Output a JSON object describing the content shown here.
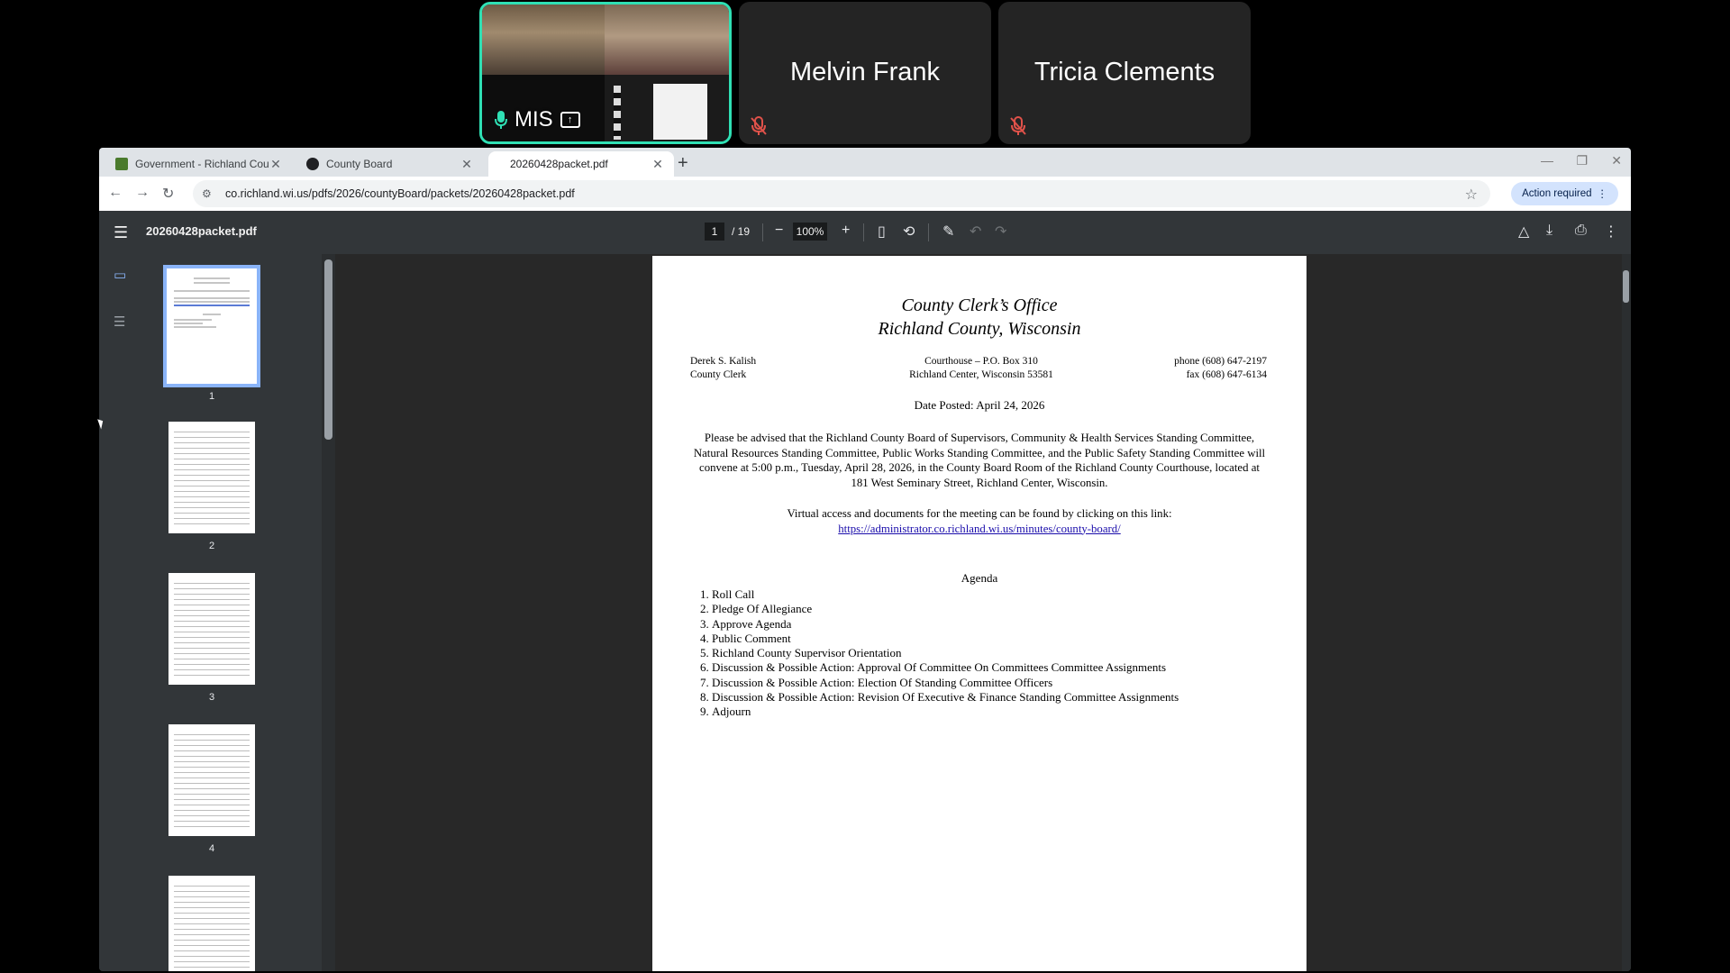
{
  "call": {
    "participants": [
      {
        "name": "MIS",
        "speaking": true
      },
      {
        "name": "Melvin Frank",
        "muted": true
      },
      {
        "name": "Tricia Clements",
        "muted": true
      }
    ]
  },
  "browser": {
    "tabs": [
      {
        "title": "Government - Richland County",
        "favicon_color": "#4a7a2c"
      },
      {
        "title": "County Board",
        "favicon_color": "#202124"
      },
      {
        "title": "20260428packet.pdf",
        "active": true
      }
    ],
    "url": "co.richland.wi.us/pdfs/2026/countyBoard/packets/20260428packet.pdf",
    "action_required_label": "Action required"
  },
  "pdf": {
    "filename": "20260428packet.pdf",
    "current_page": "1",
    "total_pages": "/ 19",
    "zoom": "100%",
    "thumbnails": [
      "1",
      "2",
      "3",
      "4"
    ],
    "document": {
      "office": "County Clerk’s Office",
      "county": "Richland County, Wisconsin",
      "clerk_name": "Derek S. Kalish",
      "clerk_title": "County Clerk",
      "address_line1": "Courthouse – P.O. Box 310",
      "address_line2": "Richland Center, Wisconsin 53581",
      "phone": "phone (608) 647-2197",
      "fax": "fax (608) 647-6134",
      "date_posted": "Date Posted: April 24, 2026",
      "notice": "Please be advised that the Richland County Board of Supervisors, Community & Health Services Standing Committee, Natural Resources Standing Committee, Public Works Standing Committee, and the Public Safety Standing Committee will convene at 5:00 p.m., Tuesday, April 28, 2026, in the County Board Room of the Richland County Courthouse, located at 181 West Seminary Street, Richland Center, Wisconsin.",
      "virtual_access": "Virtual access and documents for the meeting can be found by clicking on this link:",
      "link": "https://administrator.co.richland.wi.us/minutes/county-board/",
      "agenda_title": "Agenda",
      "agenda": [
        "Roll Call",
        "Pledge Of Allegiance",
        "Approve Agenda",
        "Public Comment",
        "Richland County Supervisor Orientation",
        "Discussion & Possible Action: Approval Of Committee On Committees Committee Assignments",
        "Discussion & Possible Action: Election Of Standing Committee Officers",
        "Discussion & Possible Action: Revision Of Executive & Finance Standing Committee Assignments",
        "Adjourn"
      ]
    }
  },
  "colors": {
    "active_speaker_border": "#2fe0b4",
    "muted_mic": "#e0524a",
    "pdf_toolbar": "#323639",
    "link": "#1a0dab"
  }
}
